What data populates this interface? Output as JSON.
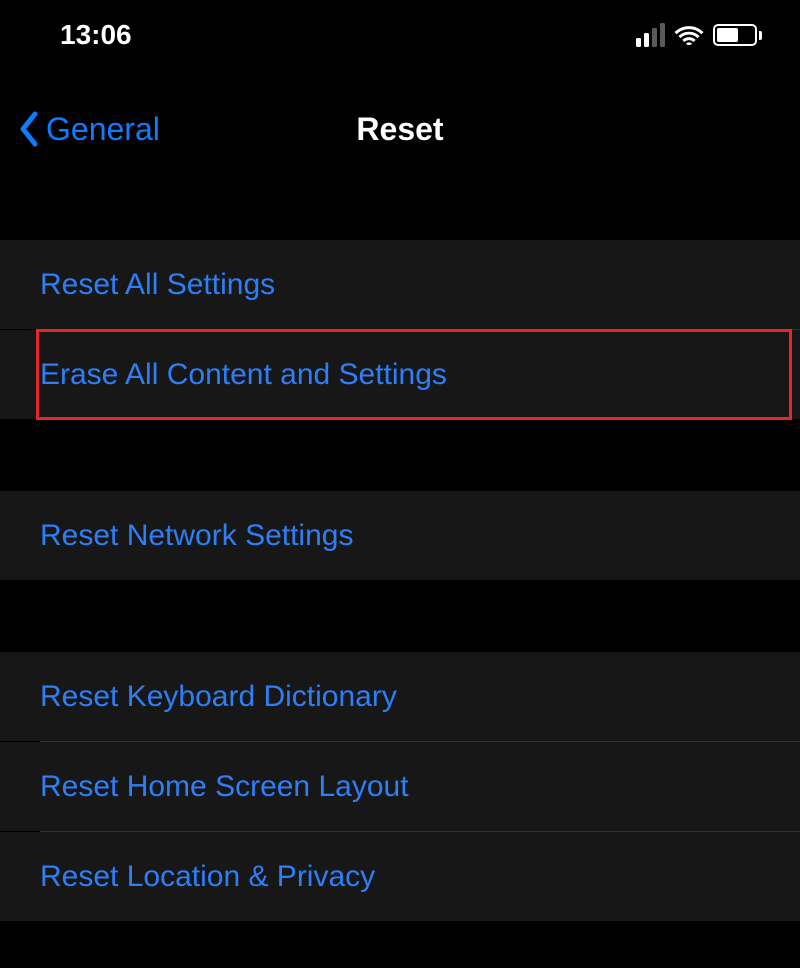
{
  "statusBar": {
    "time": "13:06"
  },
  "nav": {
    "backLabel": "General",
    "title": "Reset"
  },
  "group1": {
    "item1": "Reset All Settings",
    "item2": "Erase All Content and Settings"
  },
  "group2": {
    "item1": "Reset Network Settings"
  },
  "group3": {
    "item1": "Reset Keyboard Dictionary",
    "item2": "Reset Home Screen Layout",
    "item3": "Reset Location & Privacy"
  }
}
